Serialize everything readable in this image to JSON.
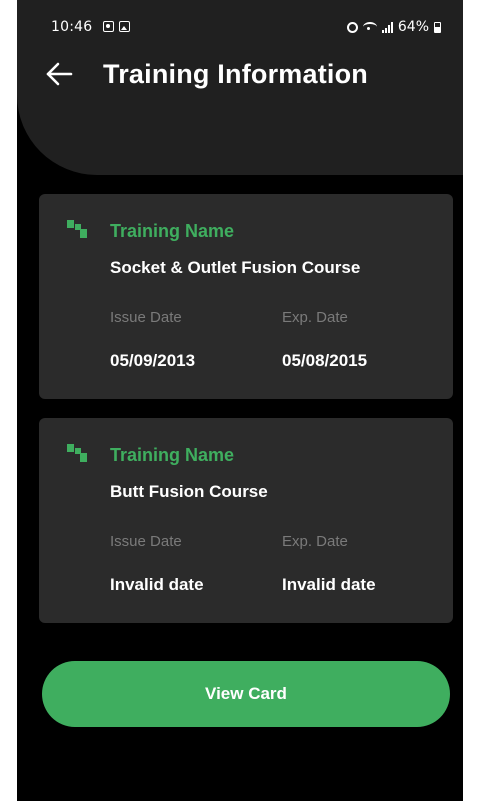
{
  "status_bar": {
    "time": "10:46",
    "battery": "64%"
  },
  "header": {
    "title": "Training Information"
  },
  "trainings": [
    {
      "field_label": "Training Name",
      "name": "Socket & Outlet Fusion Course",
      "issue_label": "Issue Date",
      "issue_date": "05/09/2013",
      "exp_label": "Exp. Date",
      "exp_date": "05/08/2015"
    },
    {
      "field_label": "Training Name",
      "name": "Butt Fusion Course",
      "issue_label": "Issue Date",
      "issue_date": "Invalid date",
      "exp_label": "Exp. Date",
      "exp_date": "Invalid date"
    }
  ],
  "actions": {
    "view_card_label": "View Card"
  },
  "colors": {
    "accent": "#3fae5f",
    "card_bg": "#2b2b2b",
    "header_bg": "#202020",
    "background": "#000000"
  },
  "icons": {
    "back": "arrow-left-icon",
    "training": "pipe-fitting-icon"
  }
}
